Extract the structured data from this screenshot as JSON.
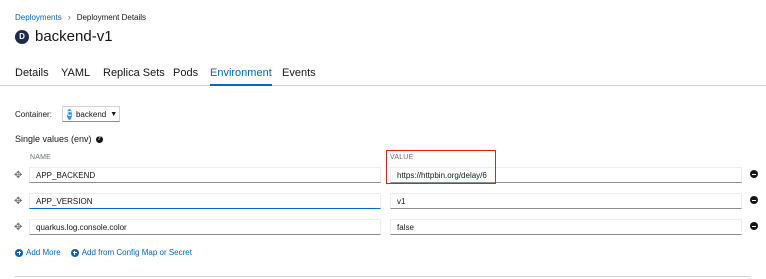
{
  "breadcrumb": {
    "parent": "Deployments",
    "current": "Deployment Details"
  },
  "resource": {
    "badge": "D",
    "name": "backend-v1"
  },
  "tabs": [
    {
      "label": "Details",
      "active": false
    },
    {
      "label": "YAML",
      "active": false
    },
    {
      "label": "Replica Sets",
      "active": false
    },
    {
      "label": "Pods",
      "active": false
    },
    {
      "label": "Environment",
      "active": true
    },
    {
      "label": "Events",
      "active": false
    }
  ],
  "container": {
    "label": "Container:",
    "badge": "C",
    "value": "backend"
  },
  "env": {
    "title": "Single values (env)",
    "name_header": "NAME",
    "value_header": "VALUE",
    "rows": [
      {
        "name": "APP_BACKEND",
        "value": "https://httpbin.org/delay/6"
      },
      {
        "name": "APP_VERSION",
        "value": "v1"
      },
      {
        "name": "quarkus.log.console.color",
        "value": "false"
      }
    ]
  },
  "actions": {
    "add_more": "Add More",
    "add_from": "Add from Config Map or Secret"
  },
  "colors": {
    "link": "#0066cc",
    "highlight": "#e0201f"
  }
}
